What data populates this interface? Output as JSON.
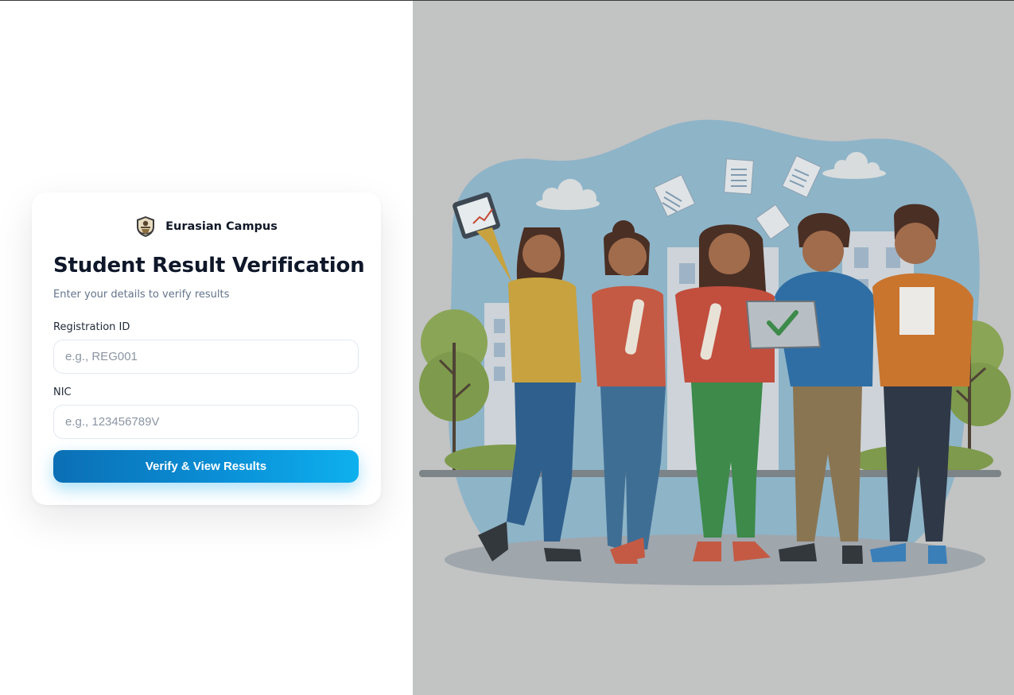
{
  "brand": {
    "name": "Eurasian Campus",
    "logo_icon": "campus-crest-icon"
  },
  "form": {
    "title": "Student Result Verification",
    "subtitle": "Enter your details to verify results",
    "registration": {
      "label": "Registration ID",
      "placeholder": "e.g., REG001",
      "value": ""
    },
    "nic": {
      "label": "NIC",
      "placeholder": "e.g., 123456789V",
      "value": ""
    },
    "submit_label": "Verify & View Results"
  },
  "theme": {
    "accent_start": "#0b6fb5",
    "accent_end": "#0eb0ee",
    "overlay": "#c2c3c3"
  }
}
